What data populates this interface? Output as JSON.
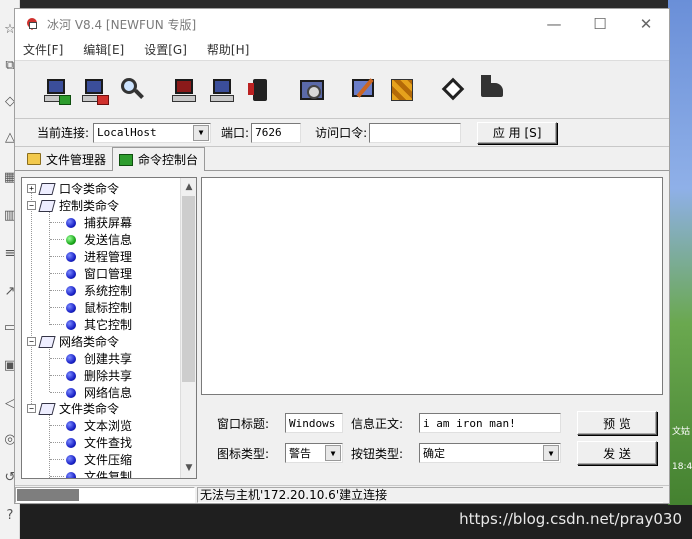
{
  "window": {
    "title": "冰河 V8.4 [NEWFUN 专版]",
    "controls": {
      "minimize": "—",
      "maximize": "☐",
      "close": "✕"
    }
  },
  "menu": [
    "文件[F]",
    "编辑[E]",
    "设置[G]",
    "帮助[H]"
  ],
  "toolbar": {
    "buttons": [
      "add-host",
      "delete-host",
      "find-host",
      "screen-capture",
      "screen-control",
      "phone",
      "settings",
      "config-server",
      "tools",
      "about",
      "exit"
    ]
  },
  "connection": {
    "current_label": "当前连接:",
    "current_value": "LocalHost",
    "port_label": "端口:",
    "port_value": "7626",
    "password_label": "访问口令:",
    "password_value": "",
    "apply_label": "应 用 [S]"
  },
  "tabs": [
    {
      "label": "文件管理器",
      "active": false
    },
    {
      "label": "命令控制台",
      "active": true
    }
  ],
  "tree": {
    "groups": [
      {
        "label": "口令类命令",
        "expander": "+",
        "children": []
      },
      {
        "label": "控制类命令",
        "expander": "−",
        "children": [
          {
            "label": "捕获屏幕",
            "color": "blue"
          },
          {
            "label": "发送信息",
            "color": "green"
          },
          {
            "label": "进程管理",
            "color": "blue"
          },
          {
            "label": "窗口管理",
            "color": "blue"
          },
          {
            "label": "系统控制",
            "color": "blue"
          },
          {
            "label": "鼠标控制",
            "color": "blue"
          },
          {
            "label": "其它控制",
            "color": "blue"
          }
        ]
      },
      {
        "label": "网络类命令",
        "expander": "−",
        "children": [
          {
            "label": "创建共享",
            "color": "blue"
          },
          {
            "label": "删除共享",
            "color": "blue"
          },
          {
            "label": "网络信息",
            "color": "blue"
          }
        ]
      },
      {
        "label": "文件类命令",
        "expander": "−",
        "children": [
          {
            "label": "文本浏览",
            "color": "blue"
          },
          {
            "label": "文件查找",
            "color": "blue"
          },
          {
            "label": "文件压缩",
            "color": "blue"
          },
          {
            "label": "文件复制",
            "color": "blue"
          }
        ]
      }
    ]
  },
  "form": {
    "window_title_label": "窗口标题:",
    "window_title_value": "Windows",
    "message_label": "信息正文:",
    "message_value": "i am iron man!",
    "icon_type_label": "图标类型:",
    "icon_type_value": "警告",
    "button_type_label": "按钮类型:",
    "button_type_value": "确定",
    "preview_label": "预 览",
    "send_label": "发 送"
  },
  "status": {
    "progress": 0.35,
    "message": "无法与主机'172.20.10.6'建立连接"
  },
  "watermark": "https://blog.csdn.net/pray030",
  "desktop_texts": [
    "文姑",
    "18:4"
  ]
}
